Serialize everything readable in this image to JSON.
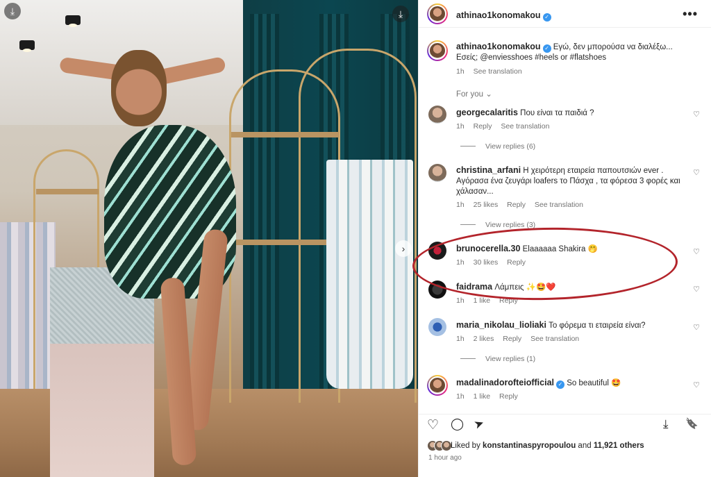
{
  "post": {
    "author": "athinao1konomakou",
    "caption": "Εγώ, δεν μπορούσα να διαλέξω... Εσείς; @enviesshoes #heels or #flatshoes",
    "caption_time": "1h",
    "see_translation": "See translation",
    "for_you": "For you",
    "likes_prefix": "Liked by",
    "likes_user": "konstantinaspyropoulou",
    "likes_and": "and",
    "likes_count": "11,921 others",
    "posted": "1 hour ago"
  },
  "comments": [
    {
      "user": "georgecalaritis",
      "text": "Που είναι τα παιδιά ?",
      "time": "1h",
      "likes": "",
      "reply": "Reply",
      "translation": "See translation",
      "replies": "View replies (6)"
    },
    {
      "user": "christina_arfani",
      "text": "Η χειρότερη εταιρεία παπουτσιών ever . Αγόρασα ένα ζευγάρι loafers το Πάσχα , τα φόρεσα 3 φορές και χάλασαν...",
      "time": "1h",
      "likes": "25 likes",
      "reply": "Reply",
      "translation": "See translation",
      "replies": "View replies (3)"
    },
    {
      "user": "brunocerella.30",
      "text": "Elaaaaaa Shakira 🤭",
      "time": "1h",
      "likes": "30 likes",
      "reply": "Reply",
      "translation": "",
      "replies": ""
    },
    {
      "user": "faidrama",
      "text": "Λάμπεις ✨🤩❤️",
      "time": "1h",
      "likes": "1 like",
      "reply": "Reply",
      "translation": "",
      "replies": ""
    },
    {
      "user": "maria_nikolau_lioliaki",
      "text": "Το φόρεμα τι εταιρεία είναι?",
      "time": "1h",
      "likes": "2 likes",
      "reply": "Reply",
      "translation": "See translation",
      "replies": "View replies (1)"
    },
    {
      "user": "madalinadorofteiofficial",
      "text": "So beautiful 🤩",
      "time": "1h",
      "likes": "1 like",
      "reply": "Reply",
      "translation": "",
      "replies": ""
    }
  ],
  "icons": {
    "heart": "♡",
    "comment": "◯",
    "share": "➤",
    "save": "🔖",
    "download": "⤓",
    "more": "•••"
  },
  "colors": {
    "verified": "#3897f0",
    "highlight_ring": "#b3242b"
  }
}
